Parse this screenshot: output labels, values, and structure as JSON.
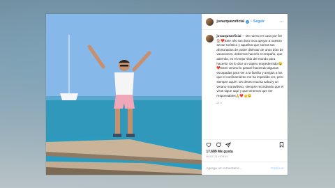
{
  "post": {
    "username": "juvazquezoficial",
    "verified_mark": "✓",
    "separator": "•",
    "follow_label": "Seguir",
    "more_icon": "more-dots-icon",
    "caption_user": "juvazquezoficial",
    "caption_text": "De nuevo en casa por fin! 🏠❤️Este año tan duro toca apoyar a nuestro sector turístico y aquellos que somos tan afortunados de poder disfrutar de unos días de vacaciones, debemos hacerlo en España, que además, es el mejor sitio del mundo para hacerlo! Os lo dice un viajero empedernido!😉❤️Esmi verano lo pasaré haciendo algunas escapadas para ver a la familia y amigos a los que el confinamiento me ha impedido ver, pero siempre aquí!!. Os deseo mucha salud y un verano maravilloso, siempre recordando que el virus sigue aquí y que tenemos que ser responsables🙏❤️👍😊",
    "time_ago": "21 h",
    "likes": "17.689 Me gusta",
    "date": "HACE 21 HORAS",
    "comment_placeholder": "Agrega un comentario...",
    "publish_label": "Publicar"
  },
  "colors": {
    "link": "#3897f0",
    "text": "#262626",
    "muted": "#999999",
    "heart": "#ed4956"
  }
}
